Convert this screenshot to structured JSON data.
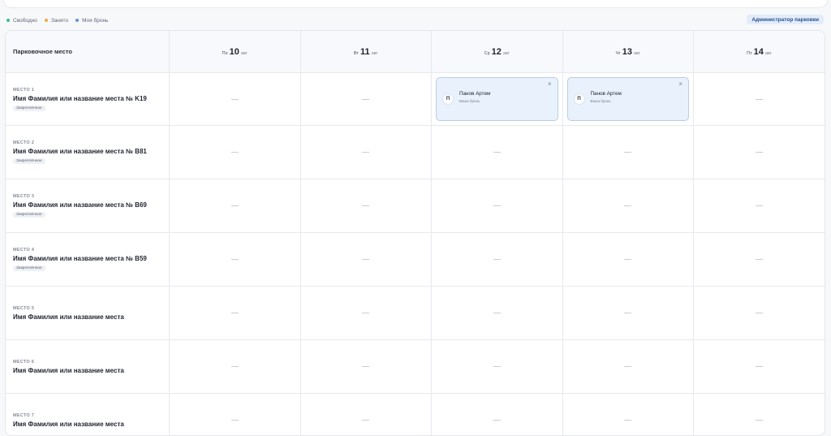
{
  "legend": [
    {
      "label": "Свободно",
      "color": "#3bb98a"
    },
    {
      "label": "Занято",
      "color": "#f2a93b"
    },
    {
      "label": "Моя бронь",
      "color": "#5b93d6"
    }
  ],
  "admin_label": "Администратор парковки",
  "table": {
    "header_title": "Парковочное место",
    "days": [
      {
        "weekday": "Пн",
        "day": "10",
        "month": "авг"
      },
      {
        "weekday": "Вт",
        "day": "11",
        "month": "авг"
      },
      {
        "weekday": "Ср",
        "day": "12",
        "month": "авг"
      },
      {
        "weekday": "Чт",
        "day": "13",
        "month": "авг"
      },
      {
        "weekday": "Пт",
        "day": "14",
        "month": "авг"
      }
    ],
    "spots": [
      {
        "code": "МЕСТО 1",
        "name": "Имя Фамилия или название места № K19",
        "tag": "Закреплённое"
      },
      {
        "code": "МЕСТО 2",
        "name": "Имя Фамилия или название места № B81",
        "tag": "Закреплённое"
      },
      {
        "code": "МЕСТО 3",
        "name": "Имя Фамилия или название места № B69",
        "tag": "Закреплённое"
      },
      {
        "code": "МЕСТО 4",
        "name": "Имя Фамилия или название места № B59",
        "tag": "Закреплённое"
      },
      {
        "code": "МЕСТО 5",
        "name": "Имя Фамилия или название места",
        "tag": ""
      },
      {
        "code": "МЕСТО 6",
        "name": "Имя Фамилия или название места",
        "tag": ""
      },
      {
        "code": "МЕСТО 7",
        "name": "Имя Фамилия или название места",
        "tag": ""
      }
    ],
    "booking": {
      "initial": "П",
      "name": "Панов Артем",
      "subtitle": "Ваша бронь",
      "close": "×"
    }
  }
}
